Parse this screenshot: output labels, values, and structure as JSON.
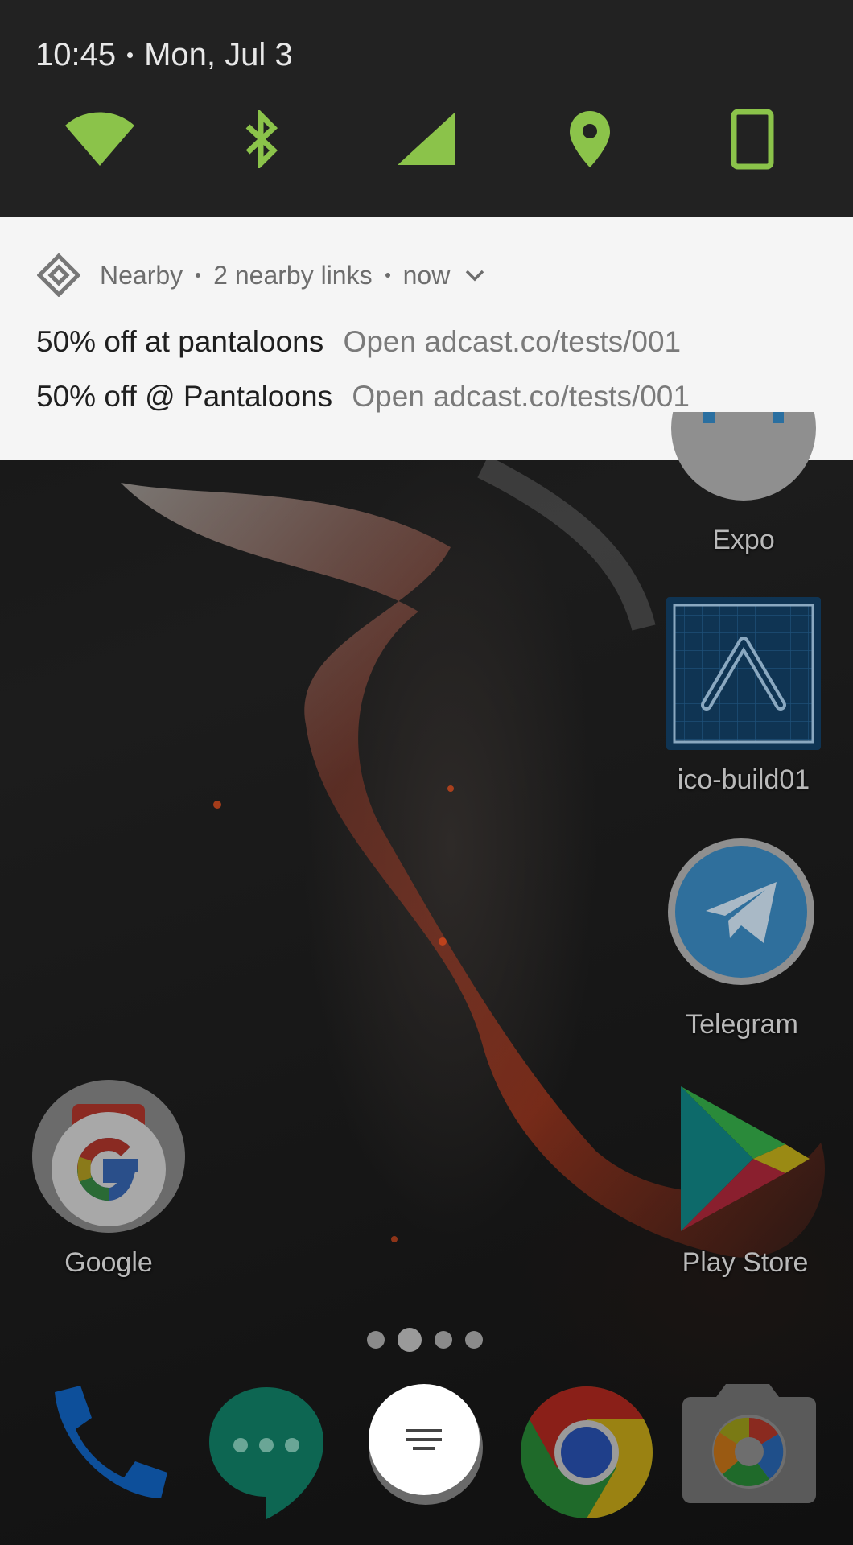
{
  "status": {
    "time": "10:45",
    "date": "Mon, Jul 3"
  },
  "quick_settings": {
    "accent_color": "#8bc34a",
    "tiles": [
      "wifi-icon",
      "bluetooth-icon",
      "cell-signal-icon",
      "location-icon",
      "auto-rotate-icon"
    ]
  },
  "notification": {
    "app_name": "Nearby",
    "summary": "2 nearby links",
    "time": "now",
    "items": [
      {
        "title": "50% off at pantaloons",
        "text": "Open adcast.co/tests/001"
      },
      {
        "title": "50% off @ Pantaloons",
        "text": "Open adcast.co/tests/001"
      }
    ]
  },
  "home_apps": {
    "expo": "Expo",
    "ico_build": "ico-build01",
    "telegram": "Telegram",
    "google": "Google",
    "play_store": "Play Store"
  },
  "dock": [
    "phone-icon",
    "hangouts-icon",
    "app-drawer-icon",
    "chrome-icon",
    "camera-icon"
  ],
  "pager": {
    "pages": 4,
    "current": 2
  }
}
